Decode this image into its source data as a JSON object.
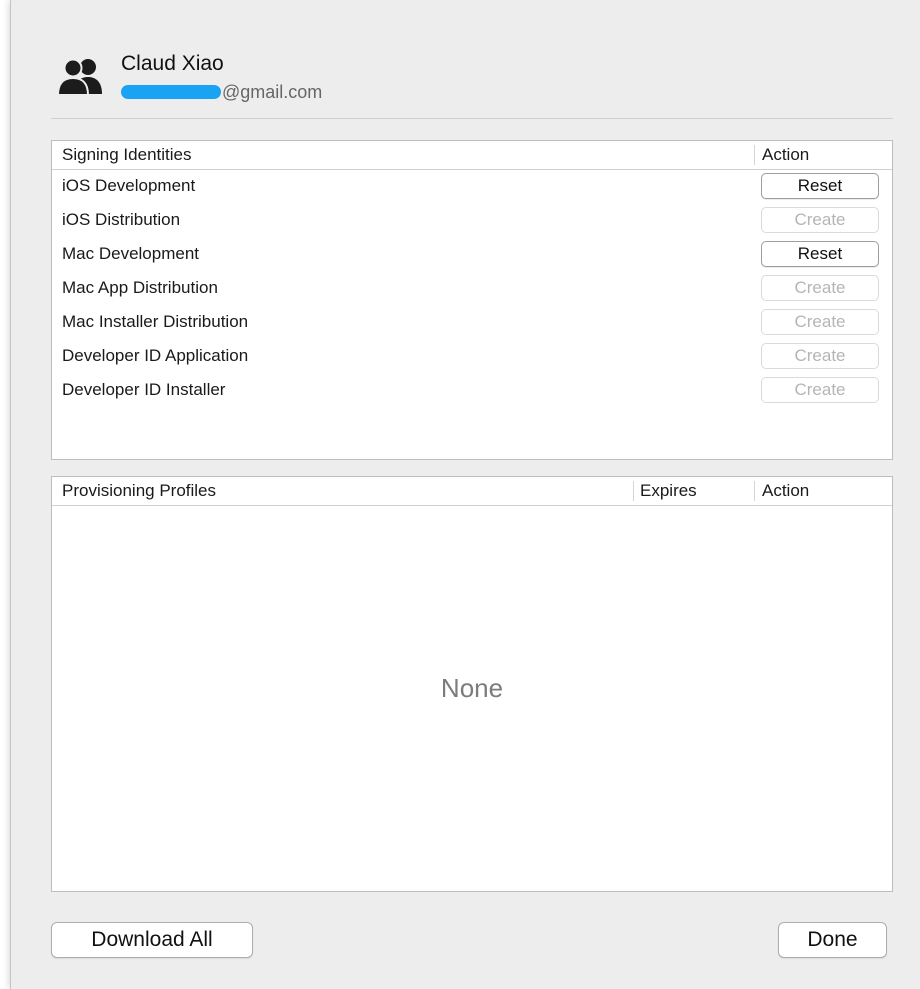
{
  "account": {
    "name": "Claud Xiao",
    "email_visible": "@gmail.com",
    "redaction_color": "#1aa3f2",
    "icon": "people-icon"
  },
  "signing_identities": {
    "header": "Signing Identities",
    "action_header": "Action",
    "rows": [
      {
        "label": "iOS Development",
        "action": "Reset",
        "enabled": true
      },
      {
        "label": "iOS Distribution",
        "action": "Create",
        "enabled": false
      },
      {
        "label": "Mac Development",
        "action": "Reset",
        "enabled": true
      },
      {
        "label": "Mac App Distribution",
        "action": "Create",
        "enabled": false
      },
      {
        "label": "Mac Installer Distribution",
        "action": "Create",
        "enabled": false
      },
      {
        "label": "Developer ID Application",
        "action": "Create",
        "enabled": false
      },
      {
        "label": "Developer ID Installer",
        "action": "Create",
        "enabled": false
      }
    ]
  },
  "provisioning_profiles": {
    "header": "Provisioning Profiles",
    "expires_header": "Expires",
    "action_header": "Action",
    "empty_text": "None"
  },
  "footer": {
    "download_all_label": "Download All",
    "done_label": "Done"
  }
}
